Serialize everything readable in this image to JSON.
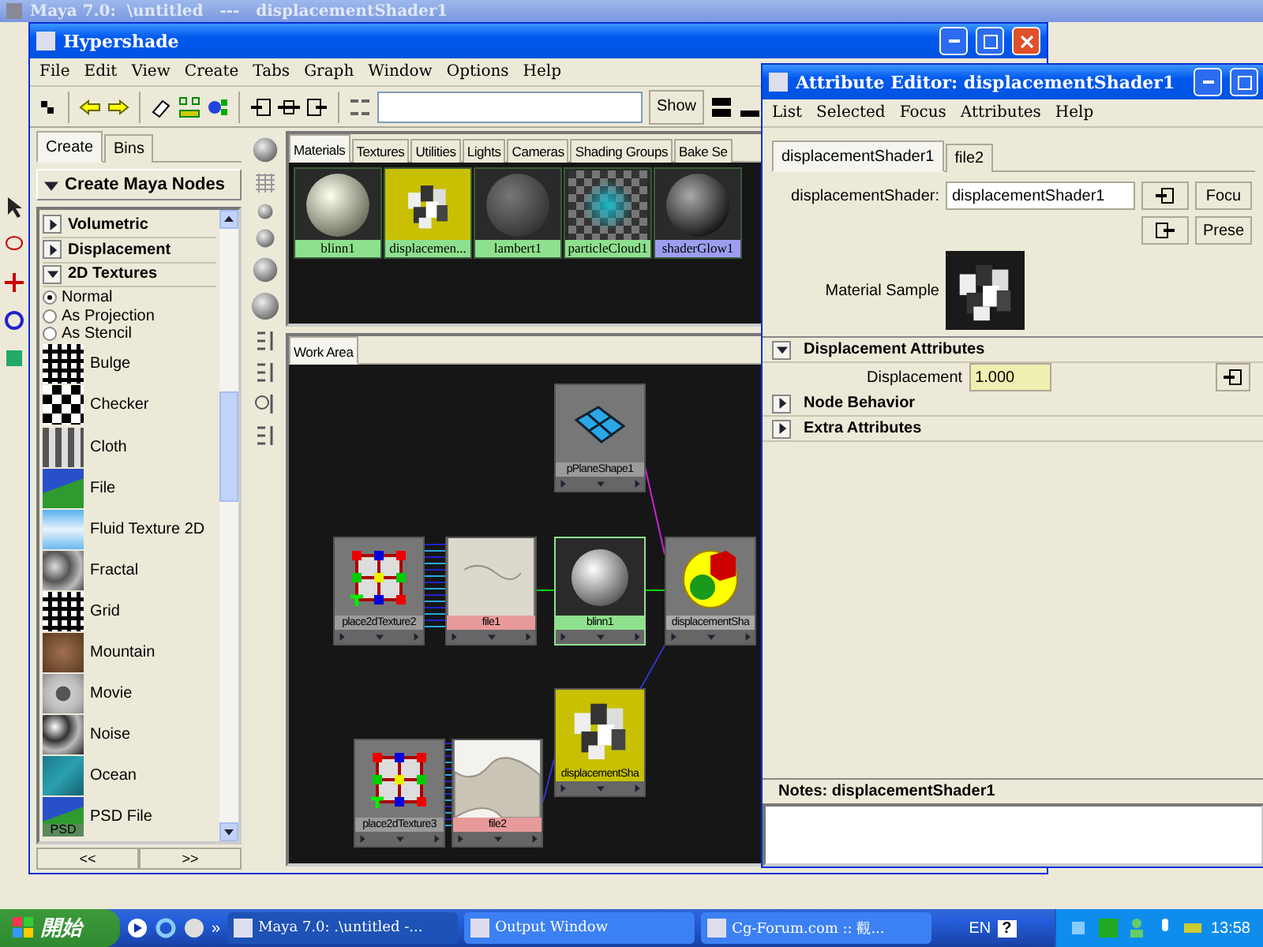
{
  "main_window": {
    "title": "Maya 7.0:  \\untitled   ---   displacementShader1"
  },
  "hypershade": {
    "title": "Hypershade",
    "menu": [
      "File",
      "Edit",
      "View",
      "Create",
      "Tabs",
      "Graph",
      "Window",
      "Options",
      "Help"
    ],
    "show_button": "Show",
    "create_panel": {
      "tabs": [
        {
          "label": "Create",
          "selected": true
        },
        {
          "label": "Bins",
          "selected": false
        }
      ],
      "header": "Create Maya Nodes",
      "sections": [
        {
          "label": "Volumetric",
          "expanded": false
        },
        {
          "label": "Displacement",
          "expanded": false
        },
        {
          "label": "2D Textures",
          "expanded": true
        }
      ],
      "modes": [
        {
          "label": "Normal",
          "selected": true
        },
        {
          "label": "As Projection",
          "selected": false
        },
        {
          "label": "As Stencil",
          "selected": false
        }
      ],
      "textures": [
        {
          "label": "Bulge",
          "kind": "bulge"
        },
        {
          "label": "Checker",
          "kind": "checker"
        },
        {
          "label": "Cloth",
          "kind": "cloth"
        },
        {
          "label": "File",
          "kind": "file"
        },
        {
          "label": "Fluid Texture 2D",
          "kind": "fluid"
        },
        {
          "label": "Fractal",
          "kind": "fractal"
        },
        {
          "label": "Grid",
          "kind": "grid"
        },
        {
          "label": "Mountain",
          "kind": "mountain"
        },
        {
          "label": "Movie",
          "kind": "movie"
        },
        {
          "label": "Noise",
          "kind": "noise"
        },
        {
          "label": "Ocean",
          "kind": "ocean"
        },
        {
          "label": "PSD File",
          "kind": "psd",
          "badge": "PSD"
        }
      ],
      "nav": [
        "<<",
        ">>"
      ]
    },
    "shelf": {
      "tabs": [
        {
          "label": "Materials",
          "selected": true
        },
        {
          "label": "Textures",
          "selected": false
        },
        {
          "label": "Utilities",
          "selected": false
        },
        {
          "label": "Lights",
          "selected": false
        },
        {
          "label": "Cameras",
          "selected": false
        },
        {
          "label": "Shading Groups",
          "selected": false
        },
        {
          "label": "Bake Se",
          "selected": false
        }
      ],
      "swatches": [
        {
          "label": "blinn1",
          "kind": "blinn",
          "selected": false,
          "color": "#8ee08e"
        },
        {
          "label": "displacemen...",
          "kind": "displacement",
          "selected": true,
          "color": "#8ee08e"
        },
        {
          "label": "lambert1",
          "kind": "lambert",
          "selected": false,
          "color": "#8ee08e"
        },
        {
          "label": "particleCloud1",
          "kind": "cloud",
          "selected": false,
          "color": "#8ee08e"
        },
        {
          "label": "shaderGlow1",
          "kind": "glow",
          "selected": false,
          "color": "#9d9df0"
        }
      ]
    },
    "work_area": {
      "tab": "Work Area",
      "nodes": [
        {
          "label": "pPlaneShape1",
          "kind": "plane",
          "color": "#9a9a9a"
        },
        {
          "label": "place2dTexture2",
          "kind": "place2d",
          "color": "#9a9a9a"
        },
        {
          "label": "file1",
          "kind": "file",
          "color": "#e89a9a"
        },
        {
          "label": "blinn1",
          "kind": "blinn",
          "color": "#8ee08e"
        },
        {
          "label": "displacementSha",
          "kind": "dispshader",
          "color": "#a8a8a8"
        },
        {
          "label": "displacementSha",
          "kind": "displacement",
          "color": "#c8c000"
        },
        {
          "label": "place2dTexture3",
          "kind": "place2d",
          "color": "#9a9a9a"
        },
        {
          "label": "file2",
          "kind": "file2",
          "color": "#e89a9a"
        }
      ]
    }
  },
  "attribute_editor": {
    "title": "Attribute Editor: displacementShader1",
    "menu": [
      "List",
      "Selected",
      "Focus",
      "Attributes",
      "Help"
    ],
    "tabs": [
      {
        "label": "displacementShader1",
        "selected": true
      },
      {
        "label": "file2",
        "selected": false
      }
    ],
    "field": {
      "label": "displacementShader:",
      "value": "displacementShader1"
    },
    "buttons": [
      "Focu",
      "Prese"
    ],
    "sample_label": "Material Sample",
    "sections": [
      {
        "label": "Displacement Attributes",
        "expanded": true,
        "attributes": [
          {
            "label": "Displacement",
            "value": "1.000"
          }
        ]
      },
      {
        "label": "Node Behavior",
        "expanded": false
      },
      {
        "label": "Extra Attributes",
        "expanded": false
      }
    ],
    "notes_label": "Notes: displacementShader1"
  },
  "taskbar": {
    "start": "開始",
    "more": "»",
    "tasks": [
      {
        "label": "Maya 7.0: .\\untitled   -...",
        "selected": true
      },
      {
        "label": "Output Window",
        "selected": false
      },
      {
        "label": "Cg-Forum.com :: 觀...",
        "selected": false
      }
    ],
    "language": "EN",
    "help": "?",
    "time": "13:58"
  }
}
